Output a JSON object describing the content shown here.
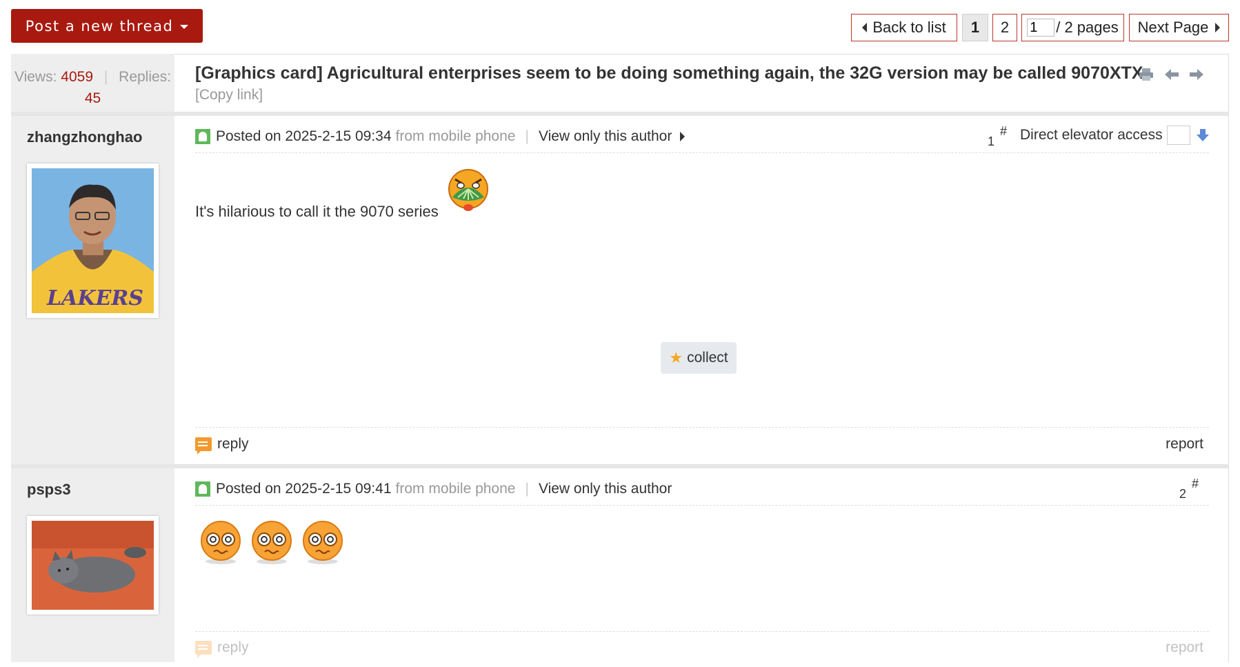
{
  "toolbar": {
    "new_thread_label": "Post a new thread",
    "back_label": "Back to list",
    "pages": [
      "1",
      "2"
    ],
    "page_input_value": "1",
    "page_total_label": "/ 2 pages",
    "next_label": "Next Page"
  },
  "thread": {
    "views_label": "Views:",
    "views": "4059",
    "replies_label": "Replies:",
    "replies": "45",
    "title": "[Graphics card] Agricultural enterprises seem to be doing something again, the 32G version may be called 9070XTX",
    "copy_link": "[Copy link]"
  },
  "posts": [
    {
      "author": "zhangzhonghao",
      "posted": "Posted on 2025-2-15 09:34",
      "source": "from mobile phone",
      "view_only": "View only this author",
      "floor_num": "1",
      "floor_hash": "#",
      "elevator_label": "Direct elevator access",
      "text": "It's hilarious to call it the 9070 series",
      "collect_label": "collect",
      "reply_label": "reply",
      "report_label": "report"
    },
    {
      "author": "psps3",
      "posted": "Posted on 2025-2-15 09:41",
      "source": "from mobile phone",
      "view_only": "View only this author",
      "floor_num": "2",
      "floor_hash": "#",
      "reply_label": "reply",
      "report_label": "report"
    }
  ]
}
